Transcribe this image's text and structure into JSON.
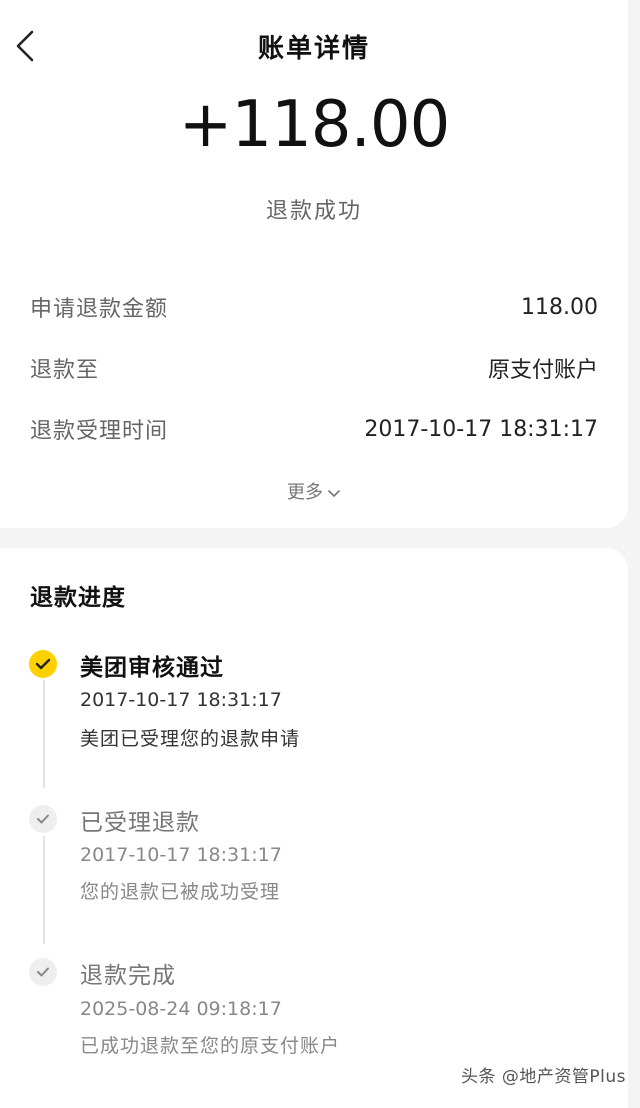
{
  "header": {
    "title": "账单详情"
  },
  "summary": {
    "amount": "+118.00",
    "status": "退款成功"
  },
  "details": [
    {
      "label": "申请退款金额",
      "value": "118.00"
    },
    {
      "label": "退款至",
      "value": "原支付账户"
    },
    {
      "label": "退款受理时间",
      "value": "2017-10-17 18:31:17"
    }
  ],
  "more_label": "更多",
  "progress": {
    "title": "退款进度",
    "steps": [
      {
        "title": "美团审核通过",
        "time": "2017-10-17 18:31:17",
        "desc": "美团已受理您的退款申请",
        "state": "active"
      },
      {
        "title": "已受理退款",
        "time": "2017-10-17 18:31:17",
        "desc": "您的退款已被成功受理",
        "state": "done"
      },
      {
        "title": "退款完成",
        "time": "2025-08-24 09:18:17",
        "desc": "已成功退款至您的原支付账户",
        "state": "done"
      }
    ]
  },
  "watermark": "头条 @地产资管Plus",
  "colors": {
    "accent": "#ffd100",
    "background": "#f4f4f4",
    "card": "#ffffff"
  },
  "icons": {
    "back": "back-arrow-icon",
    "more": "chevron-down-icon",
    "step_active": "check-circle-filled-icon",
    "step_done": "check-circle-icon"
  }
}
